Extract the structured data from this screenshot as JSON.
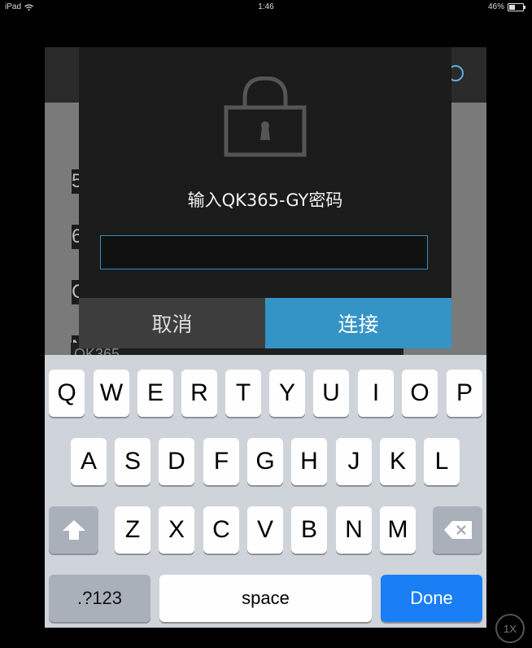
{
  "status_bar": {
    "device": "iPad",
    "time": "1:46",
    "battery": "46%",
    "battery_level": 0.46
  },
  "background_list": {
    "rows": [
      "5",
      "6",
      "C",
      "N"
    ],
    "partial_row": "QK365"
  },
  "dialog": {
    "title": "输入QK365-GY密码",
    "password_value": "",
    "cancel_label": "取消",
    "connect_label": "连接",
    "accent_color": "#3594c6"
  },
  "keyboard": {
    "row1": [
      "Q",
      "W",
      "E",
      "R",
      "T",
      "Y",
      "U",
      "I",
      "O",
      "P"
    ],
    "row2": [
      "A",
      "S",
      "D",
      "F",
      "G",
      "H",
      "J",
      "K",
      "L"
    ],
    "row3": [
      "Z",
      "X",
      "C",
      "V",
      "B",
      "N",
      "M"
    ],
    "numbers_label": ".?123",
    "space_label": "space",
    "done_label": "Done"
  },
  "zoom_badge": "1X"
}
